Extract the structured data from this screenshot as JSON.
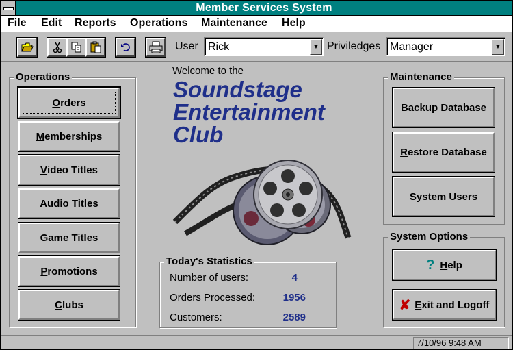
{
  "window": {
    "title": "Member Services System"
  },
  "menu": [
    {
      "pre": "",
      "u": "F",
      "post": "ile"
    },
    {
      "pre": "",
      "u": "E",
      "post": "dit"
    },
    {
      "pre": "",
      "u": "R",
      "post": "eports"
    },
    {
      "pre": "",
      "u": "O",
      "post": "perations"
    },
    {
      "pre": "",
      "u": "M",
      "post": "aintenance"
    },
    {
      "pre": "",
      "u": "H",
      "post": "elp"
    }
  ],
  "toolbar": {
    "user_label": "User",
    "user_value": "Rick",
    "privileges_label": "Priviledges",
    "privileges_value": "Manager"
  },
  "operations": {
    "label": "Operations",
    "buttons": [
      {
        "u": "O",
        "rest": "rders"
      },
      {
        "u": "M",
        "rest": "emberships"
      },
      {
        "u": "V",
        "rest": "ideo Titles"
      },
      {
        "u": "A",
        "rest": "udio Titles"
      },
      {
        "u": "G",
        "rest": "ame Titles"
      },
      {
        "u": "P",
        "rest": "romotions"
      },
      {
        "u": "C",
        "rest": "lubs"
      }
    ]
  },
  "welcome": {
    "intro": "Welcome to the",
    "line1": "Soundstage",
    "line2": "Entertainment",
    "line3": "Club"
  },
  "stats": {
    "label": "Today's Statistics",
    "rows": [
      {
        "label": "Number of users:",
        "value": "4"
      },
      {
        "label": "Orders Processed:",
        "value": "1956"
      },
      {
        "label": "Customers:",
        "value": "2589"
      }
    ]
  },
  "maintenance": {
    "label": "Maintenance",
    "buttons": [
      {
        "u": "B",
        "rest": "ackup Database"
      },
      {
        "u": "R",
        "rest": "estore Database"
      },
      {
        "u": "S",
        "rest": "ystem Users"
      }
    ]
  },
  "system_options": {
    "label": "System Options",
    "help": {
      "u": "H",
      "rest": "elp"
    },
    "exit": {
      "u": "E",
      "rest": "xit and Logoff"
    }
  },
  "status": {
    "datetime": "7/10/96 9:48 AM"
  },
  "colors": {
    "title_bar": "#008080",
    "accent_text": "#1f2f8a",
    "face": "#c0c0c0"
  }
}
